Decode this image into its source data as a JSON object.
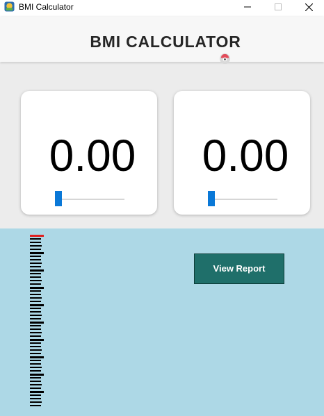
{
  "window": {
    "title": "BMI Calculator",
    "icon": "app-icon"
  },
  "header": {
    "title": "BMI CALCULATOR"
  },
  "cards": [
    {
      "value": "0.00",
      "slider_level": 0
    },
    {
      "value": "0.00",
      "slider_level": 0
    }
  ],
  "scale": {
    "tick_count": 50,
    "indicator_color": "#e02020",
    "tick_color": "#000000"
  },
  "report_button": {
    "label": "View Report"
  },
  "colors": {
    "header_bg": "#f7f7f7",
    "card_area_bg": "#ececec",
    "lower_panel_bg": "#add8e6",
    "slider_thumb": "#0a78d7",
    "button_bg": "#1f6f6a"
  }
}
